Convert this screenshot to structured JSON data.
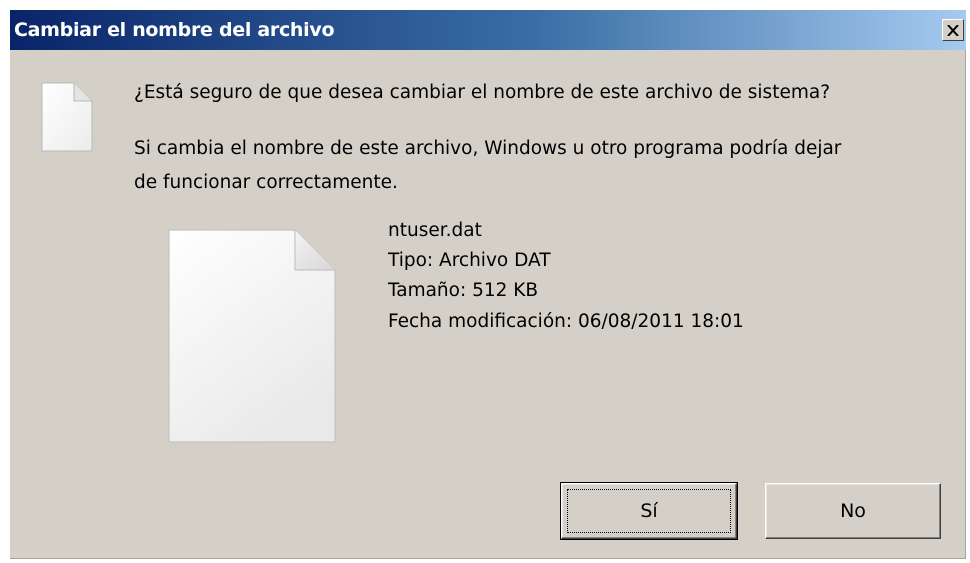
{
  "window": {
    "title": "Cambiar el nombre del archivo"
  },
  "icons": {
    "close": "close-icon",
    "document_small": "document-icon",
    "document_large": "document-icon"
  },
  "message": {
    "question": "¿Está seguro de que desea cambiar el nombre de este archivo de sistema?",
    "warning_line1": "Si cambia el nombre de este archivo, Windows u otro programa podría dejar",
    "warning_line2": "de funcionar correctamente."
  },
  "file": {
    "name": "ntuser.dat",
    "type": "Tipo: Archivo DAT",
    "size": "Tamaño: 512 KB",
    "modified": "Fecha modificación: 06/08/2011 18:01"
  },
  "buttons": {
    "yes_label": "Sí",
    "no_label": "No"
  },
  "colors": {
    "titlebar_start": "#0a246a",
    "titlebar_end": "#a6caf0",
    "dialog_background": "#d4d0c8"
  }
}
